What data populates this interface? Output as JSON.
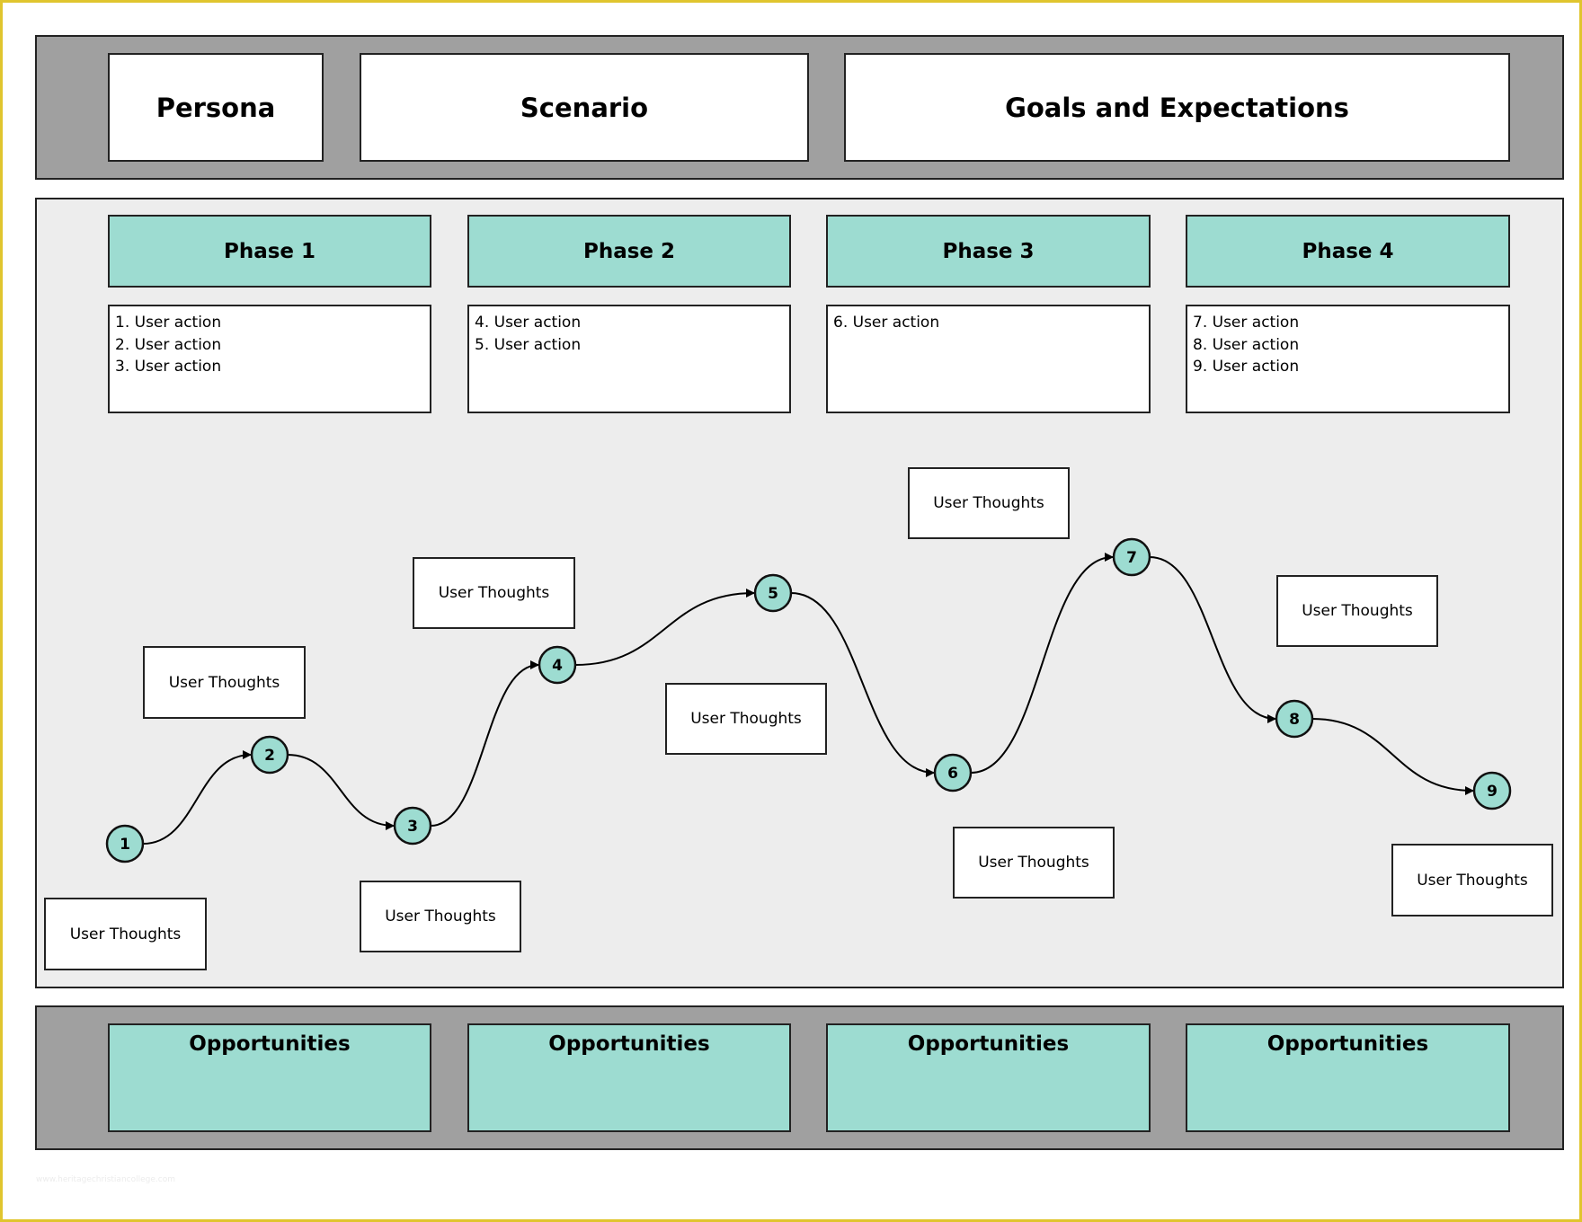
{
  "header": {
    "persona": "Persona",
    "scenario": "Scenario",
    "goals": "Goals and Expectations"
  },
  "phases": [
    {
      "title": "Phase 1",
      "actions": [
        "1. User action",
        "2. User action",
        "3. User action"
      ]
    },
    {
      "title": "Phase 2",
      "actions": [
        "4. User action",
        "5. User action"
      ]
    },
    {
      "title": "Phase 3",
      "actions": [
        "6. User action"
      ]
    },
    {
      "title": "Phase 4",
      "actions": [
        "7. User action",
        "8. User action",
        "9. User action"
      ]
    }
  ],
  "journey": {
    "nodes": [
      "1",
      "2",
      "3",
      "4",
      "5",
      "6",
      "7",
      "8",
      "9"
    ],
    "node_color": "#9ddcd1",
    "thoughts": [
      "User Thoughts",
      "User Thoughts",
      "User Thoughts",
      "User Thoughts",
      "User Thoughts",
      "User Thoughts",
      "User Thoughts",
      "User Thoughts",
      "User Thoughts"
    ]
  },
  "opportunities": [
    "Opportunities",
    "Opportunities",
    "Opportunities",
    "Opportunities"
  ],
  "watermark": "www.heritagechristiancollege.com",
  "colors": {
    "teal": "#9ddcd1",
    "band": "#a0a0a0",
    "panel": "#ededed",
    "frame": "#e0c52e"
  }
}
